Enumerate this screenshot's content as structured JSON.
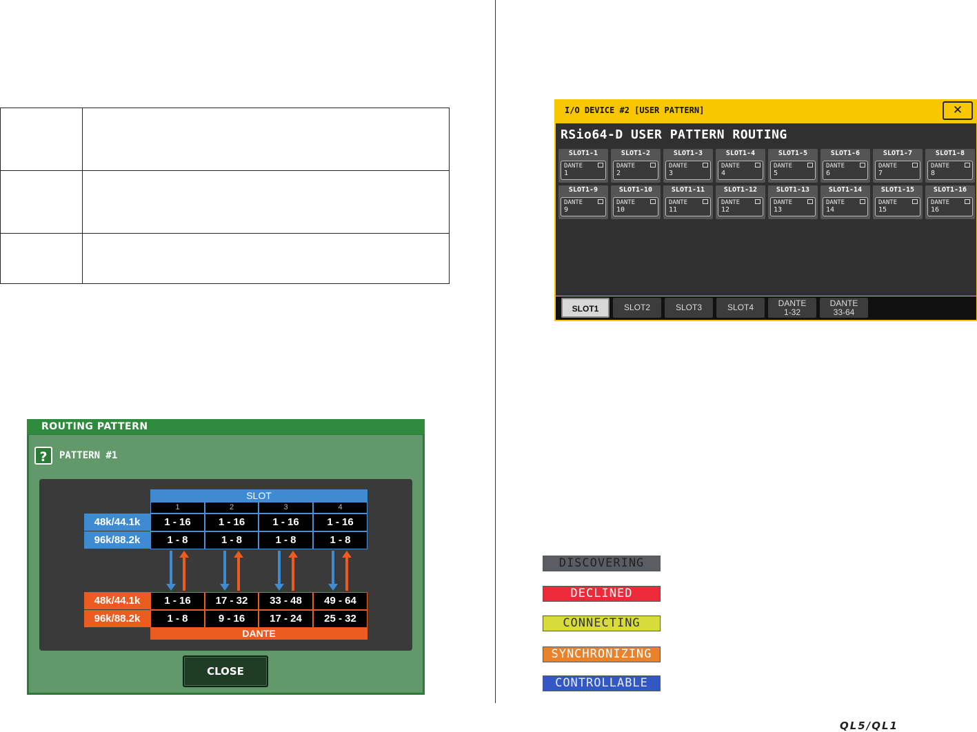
{
  "routing_pattern": {
    "title": "ROUTING PATTERN",
    "help_icon": "question-icon",
    "help_glyph": "?",
    "pattern_label": "PATTERN #1",
    "slot_header": "SLOT",
    "slot_numbers": [
      "1",
      "2",
      "3",
      "4"
    ],
    "slot_rows": [
      {
        "rate": "48k/44.1k",
        "values": [
          "1 - 16",
          "1 - 16",
          "1 - 16",
          "1 - 16"
        ]
      },
      {
        "rate": "96k/88.2k",
        "values": [
          "1 - 8",
          "1 - 8",
          "1 - 8",
          "1 - 8"
        ]
      }
    ],
    "dante_rows": [
      {
        "rate": "48k/44.1k",
        "values": [
          "1 - 16",
          "17 - 32",
          "33 - 48",
          "49 - 64"
        ]
      },
      {
        "rate": "96k/88.2k",
        "values": [
          "1 - 8",
          "9 - 16",
          "17 - 24",
          "25 - 32"
        ]
      }
    ],
    "dante_header": "DANTE",
    "close_label": "CLOSE",
    "colors": {
      "slot_blue": "#3f8bd2",
      "dante_orange": "#ec5c21",
      "dialog_green": "#62996a"
    }
  },
  "io_device": {
    "title": "I/O DEVICE #2 [USER PATTERN]",
    "close_glyph": "✕",
    "heading": "RSio64-D USER PATTERN ROUTING",
    "slots": [
      {
        "name": "SLOT1-1",
        "dante": "DANTE",
        "num": "1"
      },
      {
        "name": "SLOT1-2",
        "dante": "DANTE",
        "num": "2"
      },
      {
        "name": "SLOT1-3",
        "dante": "DANTE",
        "num": "3"
      },
      {
        "name": "SLOT1-4",
        "dante": "DANTE",
        "num": "4"
      },
      {
        "name": "SLOT1-5",
        "dante": "DANTE",
        "num": "5"
      },
      {
        "name": "SLOT1-6",
        "dante": "DANTE",
        "num": "6"
      },
      {
        "name": "SLOT1-7",
        "dante": "DANTE",
        "num": "7"
      },
      {
        "name": "SLOT1-8",
        "dante": "DANTE",
        "num": "8"
      },
      {
        "name": "SLOT1-9",
        "dante": "DANTE",
        "num": "9"
      },
      {
        "name": "SLOT1-10",
        "dante": "DANTE",
        "num": "10"
      },
      {
        "name": "SLOT1-11",
        "dante": "DANTE",
        "num": "11"
      },
      {
        "name": "SLOT1-12",
        "dante": "DANTE",
        "num": "12"
      },
      {
        "name": "SLOT1-13",
        "dante": "DANTE",
        "num": "13"
      },
      {
        "name": "SLOT1-14",
        "dante": "DANTE",
        "num": "14"
      },
      {
        "name": "SLOT1-15",
        "dante": "DANTE",
        "num": "15"
      },
      {
        "name": "SLOT1-16",
        "dante": "DANTE",
        "num": "16"
      }
    ],
    "tabs": [
      {
        "line1": "SLOT1",
        "line2": "",
        "active": true
      },
      {
        "line1": "SLOT2",
        "line2": "",
        "active": false
      },
      {
        "line1": "SLOT3",
        "line2": "",
        "active": false
      },
      {
        "line1": "SLOT4",
        "line2": "",
        "active": false
      },
      {
        "line1": "DANTE",
        "line2": "1-32",
        "active": false
      },
      {
        "line1": "DANTE",
        "line2": "33-64",
        "active": false
      }
    ],
    "colors": {
      "frame_yellow": "#f8c700",
      "body_dark": "#303030"
    }
  },
  "status_badges": [
    {
      "label": "DISCOVERING",
      "bg": "#5a5d62",
      "fg": "#222222"
    },
    {
      "label": "DECLINED",
      "bg": "#ec2a3a",
      "fg": "#ffffff"
    },
    {
      "label": "CONNECTING",
      "bg": "#d8dc3a",
      "fg": "#333333"
    },
    {
      "label": "SYNCHRONIZING",
      "bg": "#e9822a",
      "fg": "#ffffff"
    },
    {
      "label": "CONTROLLABLE",
      "bg": "#3358c4",
      "fg": "#e8ecff"
    }
  ],
  "footer": {
    "logo": "QL5/QL1"
  }
}
